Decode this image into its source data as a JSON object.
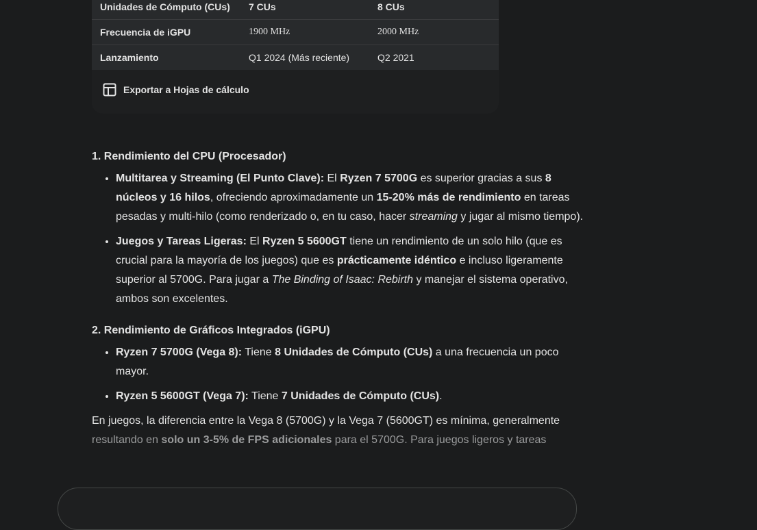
{
  "table": {
    "rows": [
      {
        "label": "Unidades de Cómputo (CUs)",
        "a": "7 CUs",
        "b": "8 CUs"
      },
      {
        "label": "Frecuencia de iGPU",
        "a": "1900 MHz",
        "b": "2000 MHz"
      },
      {
        "label": "Lanzamiento",
        "a": "Q1 2024 (Más reciente)",
        "b": "Q2 2021"
      }
    ],
    "export_label": "Exportar a Hojas de cálculo"
  },
  "section1": {
    "title": "1. Rendimiento del CPU (Procesador)",
    "item1": {
      "b1": "Multitarea y Streaming (El Punto Clave):",
      "t1": " El ",
      "b2": "Ryzen 7 5700G",
      "t2": " es superior gracias a sus ",
      "b3": "8 núcleos y 16 hilos",
      "t3": ", ofreciendo aproximadamente un ",
      "b4": "15-20% más de rendimiento",
      "t4": " en tareas pesadas y multi-hilo (como renderizado o, en tu caso, hacer ",
      "i1": "streaming",
      "t5": " y jugar al mismo tiempo)."
    },
    "item2": {
      "b1": "Juegos y Tareas Ligeras:",
      "t1": " El ",
      "b2": "Ryzen 5 5600GT",
      "t2": " tiene un rendimiento de un solo hilo (que es crucial para la mayoría de los juegos) que es ",
      "b3": "prácticamente idéntico",
      "t3": " e incluso ligeramente superior al 5700G. Para jugar a ",
      "i1": "The Binding of Isaac: Rebirth",
      "t4": " y manejar el sistema operativo, ambos son excelentes."
    }
  },
  "section2": {
    "title": "2. Rendimiento de Gráficos Integrados (iGPU)",
    "item1": {
      "b1": "Ryzen 7 5700G (Vega 8):",
      "t1": " Tiene ",
      "b2": "8 Unidades de Cómputo (CUs)",
      "t2": " a una frecuencia un poco mayor."
    },
    "item2": {
      "b1": "Ryzen 5 5600GT (Vega 7):",
      "t1": " Tiene ",
      "b2": "7 Unidades de Cómputo (CUs)",
      "t2": "."
    },
    "para": {
      "t1": "En juegos, la diferencia entre la Vega 8 (5700G) y la Vega 7 (5600GT) es mínima, generalmente ",
      "f1": "resultando en ",
      "fb": "solo un 3-5% de FPS adicionales",
      "f2": " para el 5700G. Para juegos ligeros y tareas"
    }
  }
}
